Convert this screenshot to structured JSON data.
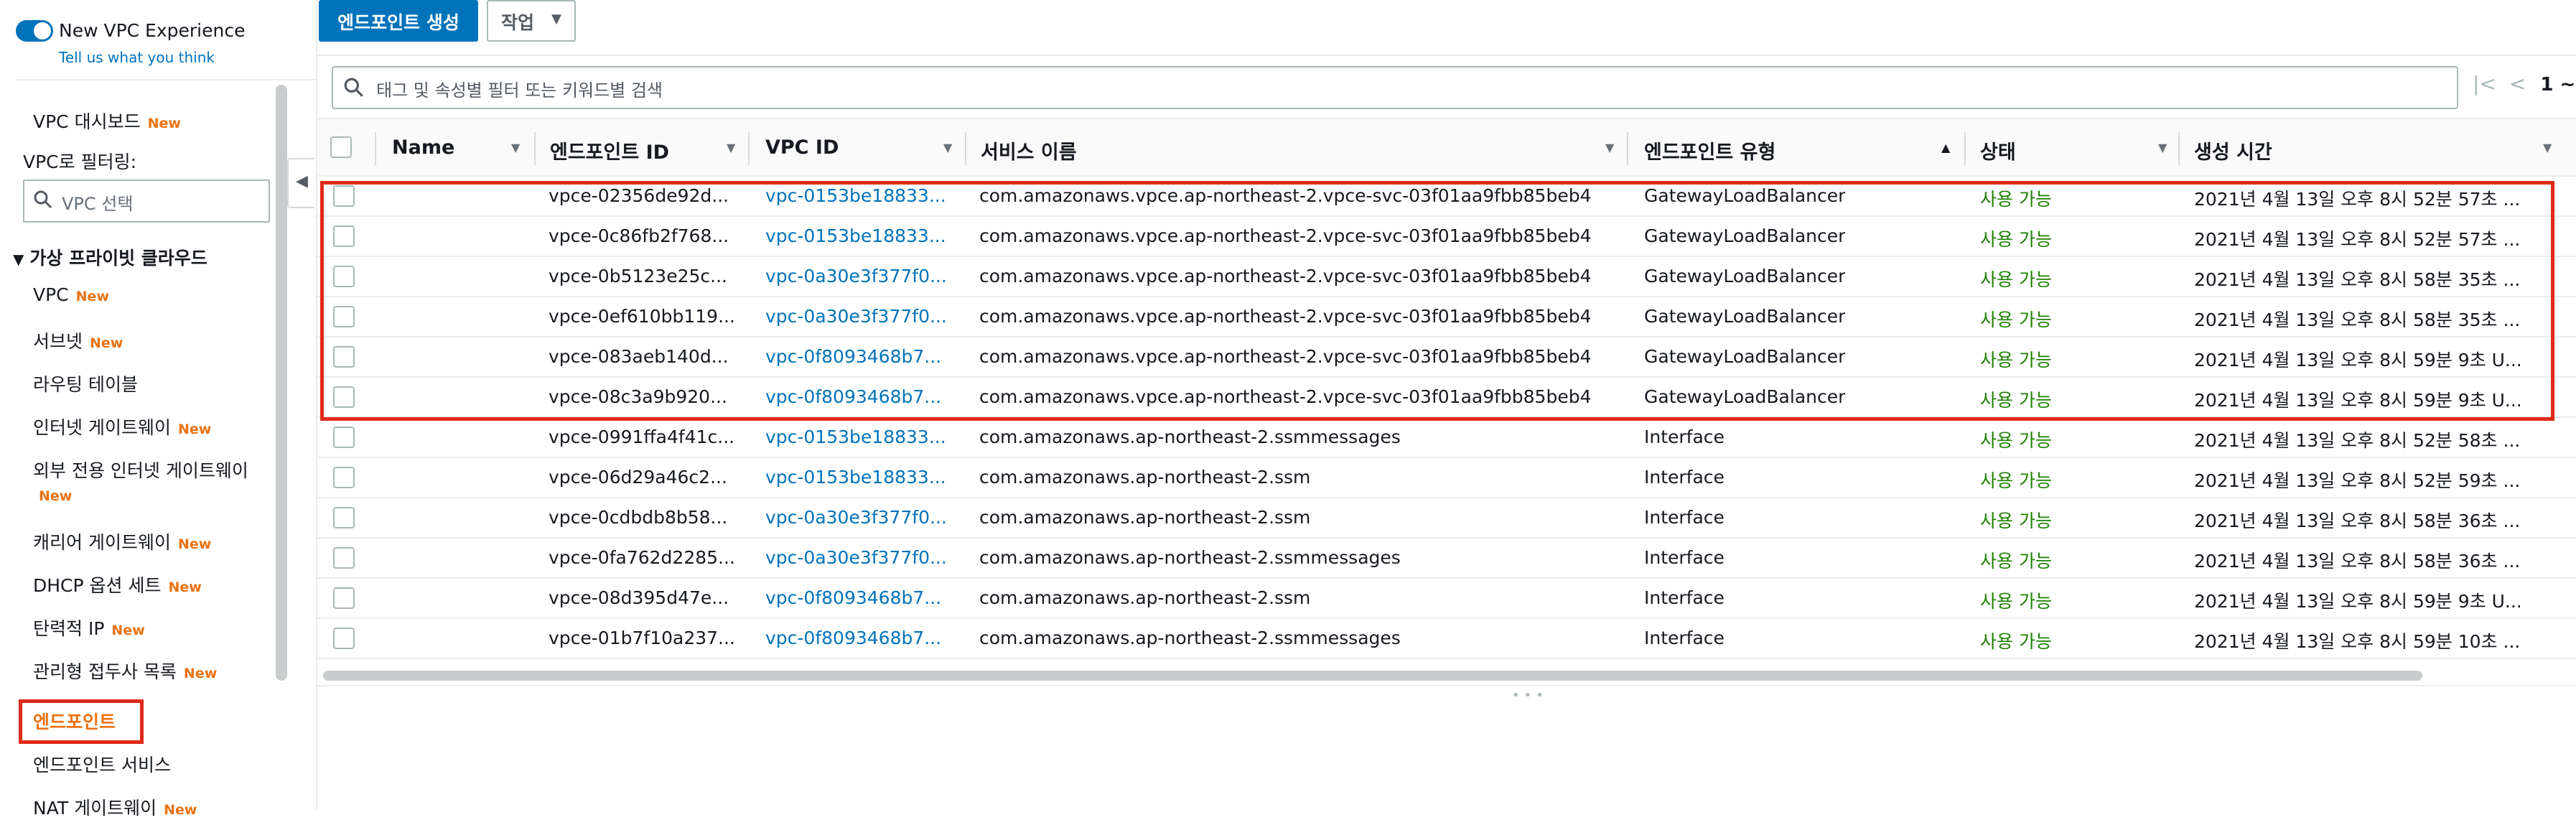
{
  "sidebar": {
    "experience_title": "New VPC Experience",
    "experience_link": "Tell us what you think",
    "dashboard": "VPC 대시보드",
    "new_badge": "New",
    "filter_label": "VPC로 필터링:",
    "filter_placeholder": "VPC 선택",
    "section_title": "가상 프라이빗 클라우드",
    "items": [
      {
        "label": "VPC",
        "new": true
      },
      {
        "label": "서브넷",
        "new": true
      },
      {
        "label": "라우팅 테이블",
        "new": false
      },
      {
        "label": "인터넷 게이트웨이",
        "new": true
      },
      {
        "label": "외부 전용 인터넷 게이트웨이",
        "new": true
      },
      {
        "label": "캐리어 게이트웨이",
        "new": true
      },
      {
        "label": "DHCP 옵션 세트",
        "new": true
      },
      {
        "label": "탄력적 IP",
        "new": true
      },
      {
        "label": "관리형 접두사 목록",
        "new": true
      },
      {
        "label": "엔드포인트",
        "new": false,
        "active": true
      },
      {
        "label": "엔드포인트 서비스",
        "new": false
      },
      {
        "label": "NAT 게이트웨이",
        "new": true
      }
    ]
  },
  "toolbar": {
    "create_label": "엔드포인트 생성",
    "actions_label": "작업",
    "search_placeholder": "태그 및 속성별 필터 또는 키워드별 검색",
    "page": "1 ~"
  },
  "table": {
    "columns": [
      "Name",
      "엔드포인트 ID",
      "VPC ID",
      "서비스 이름",
      "엔드포인트 유형",
      "상태",
      "생성 시간"
    ],
    "rows": [
      {
        "id": "vpce-02356de92d...",
        "vpc": "vpc-0153be18833...",
        "service": "com.amazonaws.vpce.ap-northeast-2.vpce-svc-03f01aa9fbb85beb4",
        "type": "GatewayLoadBalancer",
        "state": "사용 가능",
        "created": "2021년 4월 13일 오후 8시 52분 57초 ..."
      },
      {
        "id": "vpce-0c86fb2f768...",
        "vpc": "vpc-0153be18833...",
        "service": "com.amazonaws.vpce.ap-northeast-2.vpce-svc-03f01aa9fbb85beb4",
        "type": "GatewayLoadBalancer",
        "state": "사용 가능",
        "created": "2021년 4월 13일 오후 8시 52분 57초 ..."
      },
      {
        "id": "vpce-0b5123e25c...",
        "vpc": "vpc-0a30e3f377f0...",
        "service": "com.amazonaws.vpce.ap-northeast-2.vpce-svc-03f01aa9fbb85beb4",
        "type": "GatewayLoadBalancer",
        "state": "사용 가능",
        "created": "2021년 4월 13일 오후 8시 58분 35초 ..."
      },
      {
        "id": "vpce-0ef610bb119...",
        "vpc": "vpc-0a30e3f377f0...",
        "service": "com.amazonaws.vpce.ap-northeast-2.vpce-svc-03f01aa9fbb85beb4",
        "type": "GatewayLoadBalancer",
        "state": "사용 가능",
        "created": "2021년 4월 13일 오후 8시 58분 35초 ..."
      },
      {
        "id": "vpce-083aeb140d...",
        "vpc": "vpc-0f8093468b7...",
        "service": "com.amazonaws.vpce.ap-northeast-2.vpce-svc-03f01aa9fbb85beb4",
        "type": "GatewayLoadBalancer",
        "state": "사용 가능",
        "created": "2021년 4월 13일 오후 8시 59분 9초 U..."
      },
      {
        "id": "vpce-08c3a9b920...",
        "vpc": "vpc-0f8093468b7...",
        "service": "com.amazonaws.vpce.ap-northeast-2.vpce-svc-03f01aa9fbb85beb4",
        "type": "GatewayLoadBalancer",
        "state": "사용 가능",
        "created": "2021년 4월 13일 오후 8시 59분 9초 U..."
      },
      {
        "id": "vpce-0991ffa4f41c...",
        "vpc": "vpc-0153be18833...",
        "service": "com.amazonaws.ap-northeast-2.ssmmessages",
        "type": "Interface",
        "state": "사용 가능",
        "created": "2021년 4월 13일 오후 8시 52분 58초 ..."
      },
      {
        "id": "vpce-06d29a46c2...",
        "vpc": "vpc-0153be18833...",
        "service": "com.amazonaws.ap-northeast-2.ssm",
        "type": "Interface",
        "state": "사용 가능",
        "created": "2021년 4월 13일 오후 8시 52분 59초 ..."
      },
      {
        "id": "vpce-0cdbdb8b58...",
        "vpc": "vpc-0a30e3f377f0...",
        "service": "com.amazonaws.ap-northeast-2.ssm",
        "type": "Interface",
        "state": "사용 가능",
        "created": "2021년 4월 13일 오후 8시 58분 36초 ..."
      },
      {
        "id": "vpce-0fa762d2285...",
        "vpc": "vpc-0a30e3f377f0...",
        "service": "com.amazonaws.ap-northeast-2.ssmmessages",
        "type": "Interface",
        "state": "사용 가능",
        "created": "2021년 4월 13일 오후 8시 58분 36초 ..."
      },
      {
        "id": "vpce-08d395d47e...",
        "vpc": "vpc-0f8093468b7...",
        "service": "com.amazonaws.ap-northeast-2.ssm",
        "type": "Interface",
        "state": "사용 가능",
        "created": "2021년 4월 13일 오후 8시 59분 9초 U..."
      },
      {
        "id": "vpce-01b7f10a237...",
        "vpc": "vpc-0f8093468b7...",
        "service": "com.amazonaws.ap-northeast-2.ssmmessages",
        "type": "Interface",
        "state": "사용 가능",
        "created": "2021년 4월 13일 오후 8시 59분 10초 ..."
      }
    ]
  },
  "colors": {
    "accent": "#0073bb",
    "active": "#ec7211",
    "status_ok": "#1d8102",
    "highlight": "#e02a19"
  }
}
